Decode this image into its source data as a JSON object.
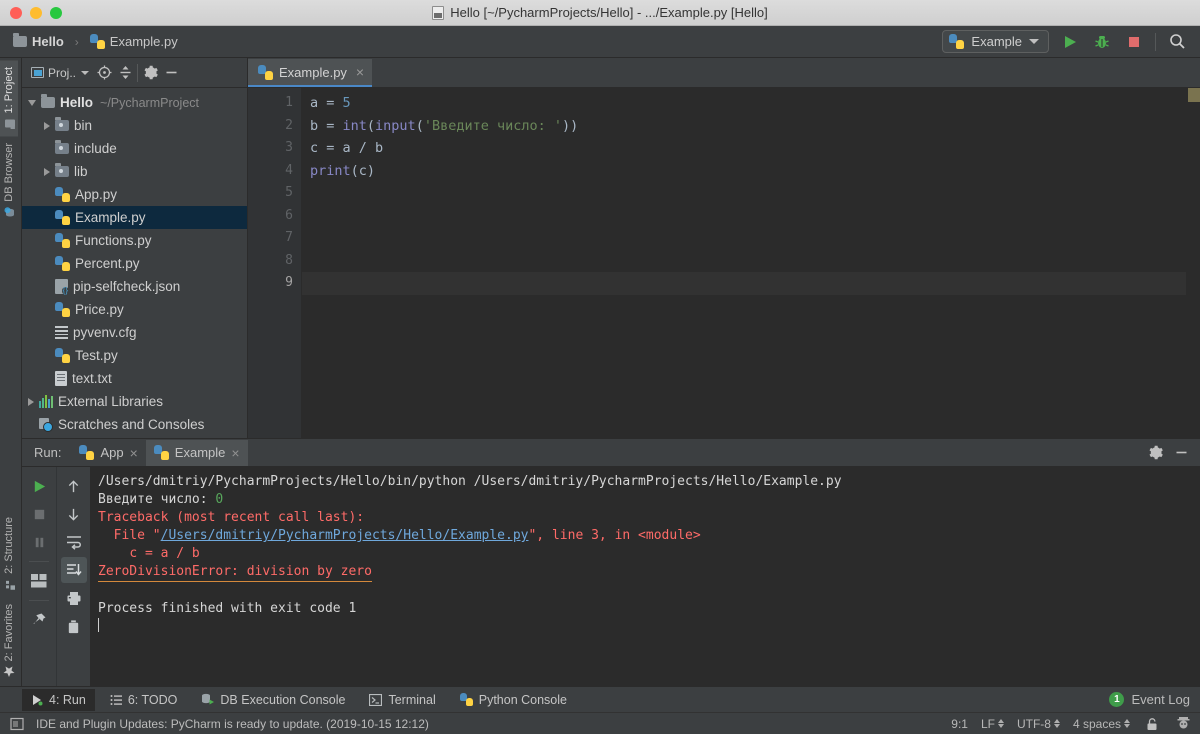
{
  "window": {
    "title": "Hello [~/PycharmProjects/Hello] - .../Example.py [Hello]",
    "title_icon": "python-file-icon"
  },
  "navbar": {
    "crumbs": [
      {
        "label": "Hello",
        "icon": "folder-icon"
      },
      {
        "label": "Example.py",
        "icon": "python-file-icon"
      }
    ],
    "separator": "›",
    "run_config": {
      "label": "Example",
      "icon": "python-file-icon"
    },
    "buttons": [
      {
        "name": "run-button",
        "label": "Run"
      },
      {
        "name": "debug-button",
        "label": "Debug"
      },
      {
        "name": "stop-button",
        "label": "Stop"
      },
      {
        "name": "search-everywhere-button",
        "label": "Search"
      }
    ]
  },
  "left_strip": {
    "top": [
      {
        "label": "1: Project",
        "underline": "1",
        "icon": "project-icon",
        "active": true
      },
      {
        "label": "DB Browser",
        "icon": "db-browser-icon",
        "active": false
      }
    ],
    "bottom": [
      {
        "label": "2: Structure",
        "underline": "7",
        "icon": "structure-icon",
        "active": false
      },
      {
        "label": "2: Favorites",
        "underline": "2",
        "icon": "star-icon",
        "active": false
      }
    ]
  },
  "project_panel": {
    "title": "Proj..",
    "header_icons": [
      {
        "name": "select-opened-file-icon"
      },
      {
        "name": "collapse-all-icon"
      },
      {
        "name": "settings-gear-icon"
      },
      {
        "name": "hide-panel-icon"
      }
    ],
    "tree": [
      {
        "label": "Hello",
        "path": "~/PycharmProject",
        "icon": "folder-icon",
        "indent": 0,
        "arrow": "down",
        "bold": true,
        "selected": false
      },
      {
        "label": "bin",
        "icon": "folder-dark-icon",
        "indent": 1,
        "arrow": "right",
        "selected": false
      },
      {
        "label": "include",
        "icon": "folder-dark-icon",
        "indent": 1,
        "arrow": "none",
        "selected": false
      },
      {
        "label": "lib",
        "icon": "folder-dark-icon",
        "indent": 1,
        "arrow": "right",
        "selected": false
      },
      {
        "label": "App.py",
        "icon": "python-file-icon",
        "indent": 1,
        "arrow": "none",
        "selected": false
      },
      {
        "label": "Example.py",
        "icon": "python-file-icon",
        "indent": 1,
        "arrow": "none",
        "selected": true
      },
      {
        "label": "Functions.py",
        "icon": "python-file-icon",
        "indent": 1,
        "arrow": "none",
        "selected": false
      },
      {
        "label": "Percent.py",
        "icon": "python-file-icon",
        "indent": 1,
        "arrow": "none",
        "selected": false
      },
      {
        "label": "pip-selfcheck.json",
        "icon": "json-file-icon",
        "indent": 1,
        "arrow": "none",
        "selected": false
      },
      {
        "label": "Price.py",
        "icon": "python-file-icon",
        "indent": 1,
        "arrow": "none",
        "selected": false
      },
      {
        "label": "pyvenv.cfg",
        "icon": "config-file-icon",
        "indent": 1,
        "arrow": "none",
        "selected": false
      },
      {
        "label": "Test.py",
        "icon": "python-file-icon",
        "indent": 1,
        "arrow": "none",
        "selected": false
      },
      {
        "label": "text.txt",
        "icon": "text-file-icon",
        "indent": 1,
        "arrow": "none",
        "selected": false
      },
      {
        "label": "External Libraries",
        "icon": "libraries-icon",
        "indent": 0,
        "arrow": "right",
        "selected": false
      },
      {
        "label": "Scratches and Consoles",
        "icon": "scratches-icon",
        "indent": 0,
        "arrow": "none",
        "selected": false
      }
    ]
  },
  "editor": {
    "tab": {
      "label": "Example.py",
      "icon": "python-file-icon",
      "close": "×"
    },
    "line_numbers": [
      "1",
      "2",
      "3",
      "4",
      "5",
      "6",
      "7",
      "8",
      "9"
    ],
    "current_line": 9,
    "code_lines": [
      [
        {
          "t": "a = ",
          "c": "def"
        },
        {
          "t": "5",
          "c": "num"
        }
      ],
      [
        {
          "t": "b = ",
          "c": "def"
        },
        {
          "t": "int",
          "c": "fn"
        },
        {
          "t": "(",
          "c": "def"
        },
        {
          "t": "input",
          "c": "fn"
        },
        {
          "t": "(",
          "c": "def"
        },
        {
          "t": "'Введите число: '",
          "c": "str"
        },
        {
          "t": "))",
          "c": "def"
        }
      ],
      [
        {
          "t": "c = a / b",
          "c": "def"
        }
      ],
      [
        {
          "t": "print",
          "c": "fn"
        },
        {
          "t": "(c)",
          "c": "def"
        }
      ]
    ],
    "markers": [
      "warning-marker-top",
      "warning-marker-bottom"
    ]
  },
  "run_panel": {
    "label": "Run:",
    "tabs": [
      {
        "label": "App",
        "icon": "python-run-icon",
        "active": false,
        "close": "×"
      },
      {
        "label": "Example",
        "icon": "python-run-icon",
        "active": true,
        "close": "×"
      }
    ],
    "header_right": [
      {
        "name": "settings-gear-icon"
      },
      {
        "name": "hide-panel-icon"
      }
    ],
    "left_icons": [
      {
        "name": "rerun-button"
      },
      {
        "name": "stop-button"
      },
      {
        "name": "pause-button"
      },
      {
        "name": "layout-button"
      },
      {
        "name": "pin-tab-button"
      }
    ],
    "right_icons": [
      {
        "name": "up-arrow-button"
      },
      {
        "name": "down-arrow-button"
      },
      {
        "name": "soft-wrap-button"
      },
      {
        "name": "scroll-to-end-button",
        "active": true
      },
      {
        "name": "print-button"
      },
      {
        "name": "clear-all-button"
      }
    ],
    "console": {
      "command": "/Users/dmitriy/PycharmProjects/Hello/bin/python /Users/dmitriy/PycharmProjects/Hello/Example.py",
      "prompt": "Введите число: ",
      "user_input": "0",
      "traceback_header": "Traceback (most recent call last):",
      "file_prefix": "  File \"",
      "file_link": "/Users/dmitriy/PycharmProjects/Hello/Example.py",
      "file_suffix": "\", line 3, in <module>",
      "code_frame": "    c = a / b",
      "exception": "ZeroDivisionError: division by zero",
      "exit_message": "Process finished with exit code 1"
    }
  },
  "bottom_bar": {
    "tabs": [
      {
        "label": "4: Run",
        "underline": "4",
        "icon": "run-icon",
        "active": true
      },
      {
        "label": "6: TODO",
        "underline": "6",
        "icon": "todo-icon",
        "active": false
      },
      {
        "label": "DB Execution Console",
        "icon": "db-console-icon",
        "active": false
      },
      {
        "label": "Terminal",
        "icon": "terminal-icon",
        "active": false
      },
      {
        "label": "Python Console",
        "icon": "python-console-icon",
        "active": false
      }
    ],
    "event_log": {
      "label": "Event Log",
      "count": "1"
    }
  },
  "status_bar": {
    "message": "IDE and Plugin Updates: PyCharm is ready to update. (2019-10-15 12:12)",
    "caret_position": "9:1",
    "line_separator": "LF",
    "encoding": "UTF-8",
    "indent": "4 spaces",
    "icons": [
      {
        "name": "lock-open-icon"
      },
      {
        "name": "inspector-icon"
      }
    ]
  },
  "colors": {
    "accent": "#4a88c7",
    "error": "#ff6b68",
    "string": "#6a8759",
    "number": "#6897bb",
    "function": "#8888c6",
    "selection": "#0d293e",
    "badge_green": "#3f9c4a"
  }
}
